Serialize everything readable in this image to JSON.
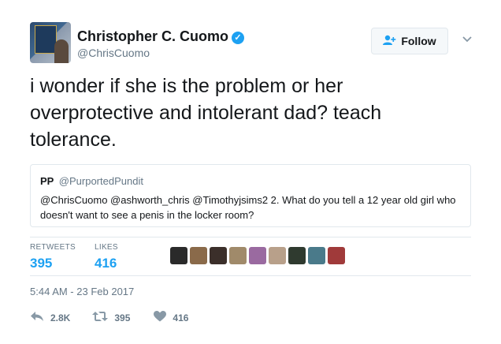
{
  "user": {
    "name": "Christopher C. Cuomo",
    "handle": "@ChrisCuomo",
    "verified": true
  },
  "follow_button": {
    "label": "Follow",
    "icon": "add-user-icon"
  },
  "menu": {
    "icon": "chevron-down-icon"
  },
  "tweet": {
    "text": "i wonder if she is the problem or her\noverprotective and intolerant dad? teach\ntolerance."
  },
  "quoted_tweet": {
    "name": "PP",
    "handle": "@PurportedPundit",
    "text": "@ChrisCuomo @ashworth_chris @Timothyjsims2 2. What do you tell a 12 year old girl who doesn't want to see a penis in the locker room?"
  },
  "stats": {
    "retweets_label": "RETWEETS",
    "retweets_count": "395",
    "likes_label": "LIKES",
    "likes_count": "416"
  },
  "likers": [
    {
      "color": "#2a2a2a"
    },
    {
      "color": "#8a6a4a"
    },
    {
      "color": "#3b2f2a"
    },
    {
      "color": "#a08a6a"
    },
    {
      "color": "#9a6aa0"
    },
    {
      "color": "#b8a08a"
    },
    {
      "color": "#2f3a2f"
    },
    {
      "color": "#4a7a8a"
    },
    {
      "color": "#a03a3a"
    }
  ],
  "timestamp": "5:44 AM - 23 Feb 2017",
  "actions": {
    "reply": {
      "icon": "reply-icon",
      "count": "2.8K"
    },
    "retweet": {
      "icon": "retweet-icon",
      "count": "395"
    },
    "like": {
      "icon": "heart-icon",
      "count": "416"
    }
  },
  "colors": {
    "accent": "#1da1f2",
    "muted": "#657786",
    "border": "#e1e8ed"
  }
}
